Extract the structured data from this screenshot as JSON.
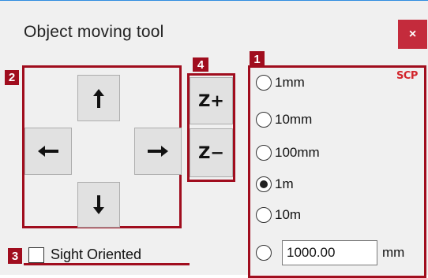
{
  "window": {
    "title": "Object moving tool",
    "close_label": "×"
  },
  "badges": {
    "b1": "1",
    "b2": "2",
    "b3": "3",
    "b4": "4"
  },
  "direction_pad": {
    "up_icon": "arrow-up-icon",
    "left_icon": "arrow-left-icon",
    "right_icon": "arrow-right-icon",
    "down_icon": "arrow-down-icon"
  },
  "z_buttons": {
    "z_plus": "Z+",
    "z_minus": "Z−"
  },
  "step_options": [
    {
      "label": "1mm",
      "selected": false
    },
    {
      "label": "10mm",
      "selected": false
    },
    {
      "label": "100mm",
      "selected": false
    },
    {
      "label": "1m",
      "selected": true
    },
    {
      "label": "10m",
      "selected": false
    }
  ],
  "custom_step": {
    "value": "1000.00",
    "unit": "mm",
    "selected": false
  },
  "logo": "SCP",
  "sight_oriented": {
    "label": "Sight Oriented",
    "checked": false
  },
  "colors": {
    "annotation_red": "#a00d1e",
    "close_button": "#c42b3c",
    "window_bg": "#f0f0f0"
  }
}
